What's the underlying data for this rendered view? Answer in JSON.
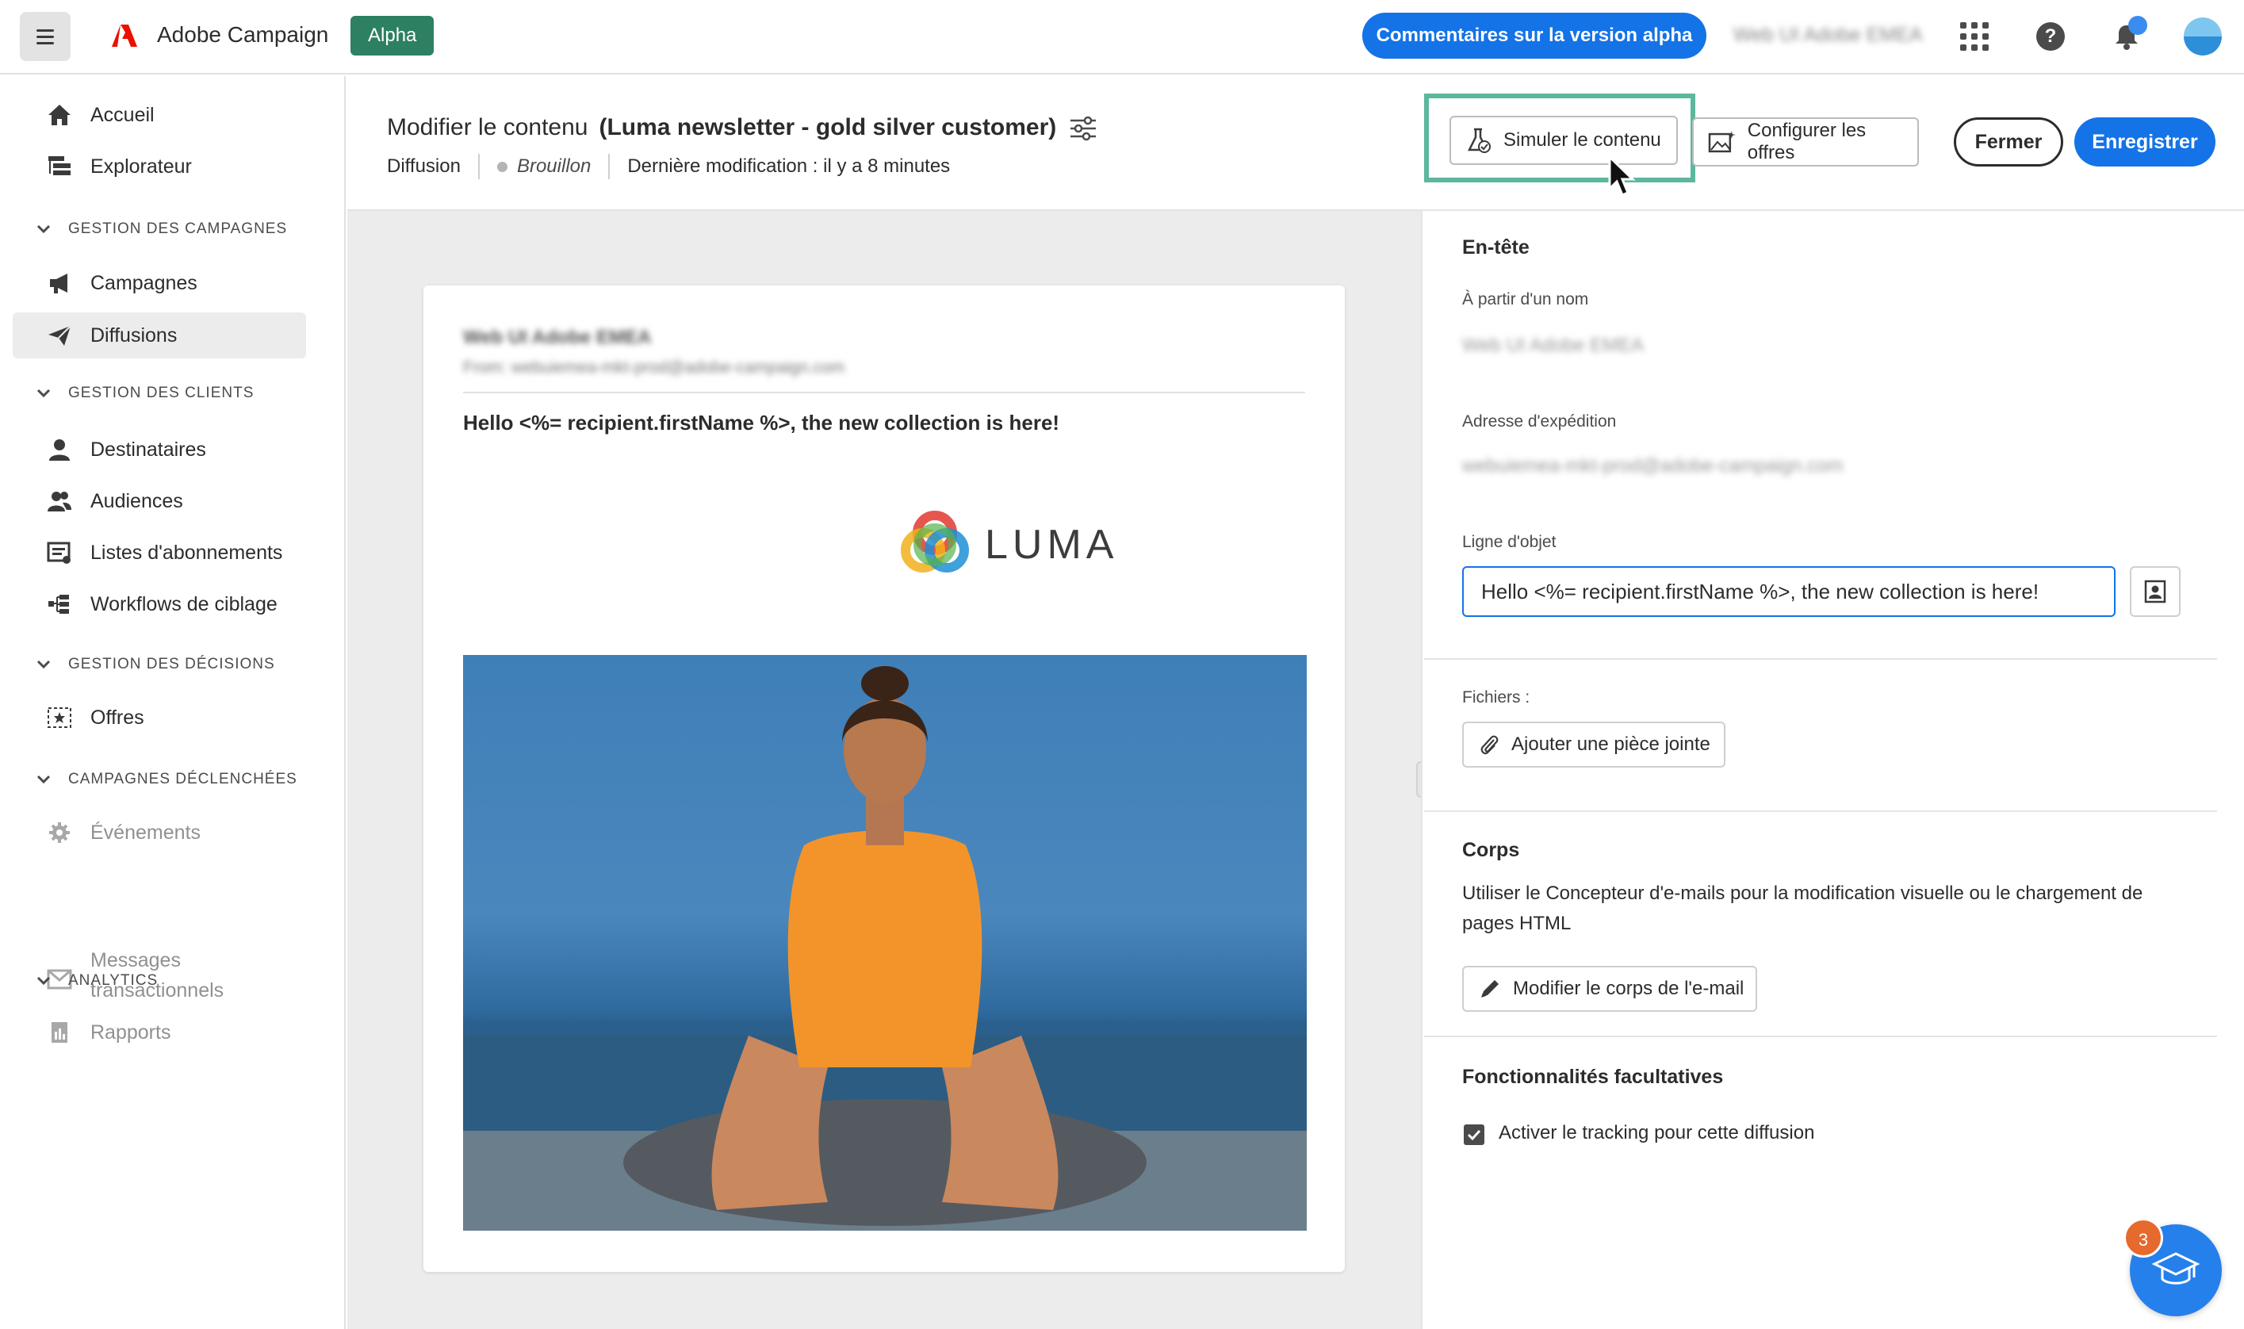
{
  "topbar": {
    "app_name": "Adobe Campaign",
    "badge": "Alpha",
    "feedback_button": "Commentaires sur la version alpha",
    "org_name": "Web UI Adobe EMEA",
    "brand_color": "#1473e6"
  },
  "sidebar": {
    "home": "Accueil",
    "explorer": "Explorateur",
    "sections": [
      {
        "title": "GESTION DES CAMPAGNES",
        "items": [
          "Campagnes",
          "Diffusions"
        ]
      },
      {
        "title": "GESTION DES CLIENTS",
        "items": [
          "Destinataires",
          "Audiences",
          "Listes d'abonnements",
          "Workflows de ciblage"
        ]
      },
      {
        "title": "GESTION DES DÉCISIONS",
        "items": [
          "Offres"
        ]
      },
      {
        "title": "CAMPAGNES DÉCLENCHÉES",
        "items": [
          "Événements",
          "Messages",
          "transactionnels"
        ]
      },
      {
        "title": "ANALYTICS",
        "items": [
          "Rapports"
        ]
      }
    ],
    "active_item": "Diffusions"
  },
  "header": {
    "title": "Modifier le contenu",
    "subtitle": "(Luma newsletter - gold silver customer)",
    "type": "Diffusion",
    "status": "Brouillon",
    "last_modified": "Dernière modification : il y a 8 minutes",
    "simulate_button": "Simuler le contenu",
    "offers_button": "Configurer les offres",
    "close_button": "Fermer",
    "save_button": "Enregistrer"
  },
  "preview": {
    "from_name": "Web UI Adobe EMEA",
    "from_address": "From: webuiemea-mkt-prod@adobe-campaign.com",
    "subject": "Hello <%= recipient.firstName %>, the new collection is here!",
    "logo_text": "LUMA"
  },
  "panel": {
    "header_title": "En-tête",
    "from_name_label": "À partir d'un nom",
    "from_name_value": "Web UI Adobe EMEA",
    "from_address_label": "Adresse d'expédition",
    "from_address_value": "webuiemea-mkt-prod@adobe-campaign.com",
    "subject_label": "Ligne d'objet",
    "subject_value": "Hello <%= recipient.firstName %>, the new collection is here!",
    "files_label": "Fichiers :",
    "attach_button": "Ajouter une pièce jointe",
    "body_title": "Corps",
    "body_text": "Utiliser le Concepteur d'e-mails pour la modification visuelle ou le chargement de pages HTML",
    "edit_body_button": "Modifier le corps de l'e-mail",
    "optional_title": "Fonctionnalités facultatives",
    "tracking_label": "Activer le tracking pour cette diffusion",
    "tracking_checked": true
  },
  "learn_badge": "3"
}
